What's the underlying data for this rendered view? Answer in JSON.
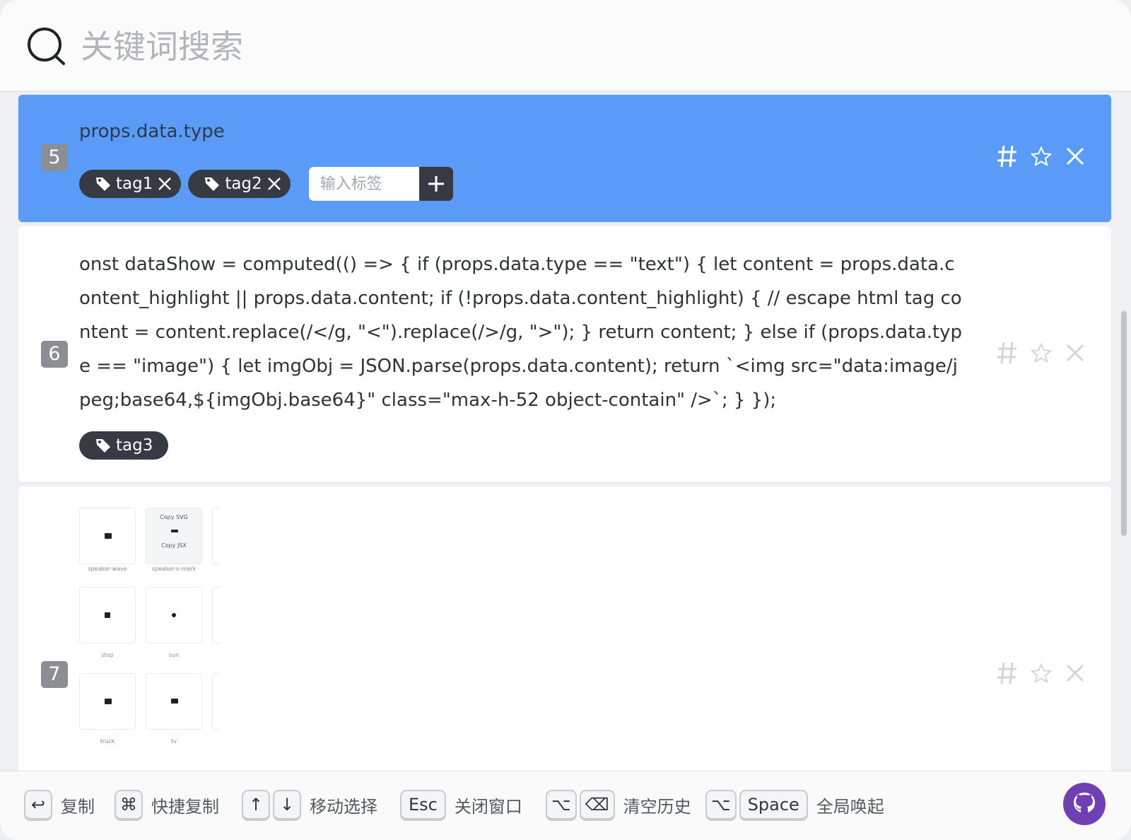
{
  "search": {
    "placeholder": "关键词搜索"
  },
  "items": [
    {
      "index": "5",
      "text": "props.data.type",
      "tags": [
        "tag1",
        "tag2"
      ],
      "tag_input_placeholder": "输入标签"
    },
    {
      "index": "6",
      "text": "onst dataShow = computed(() => { if (props.data.type == \"text\") { let content = props.data.content_highlight || props.data.content; if (!props.data.content_highlight) { // escape html tag content = content.replace(/</g, \"<\").replace(/>/g, \">\"); } return content; } else if (props.data.type == \"image\") { let imgObj = JSON.parse(props.data.content); return `<img src=\"data:image/jpeg;base64,${imgObj.base64}\" class=\"max-h-52 object-contain\" />`; } });",
      "tags": [
        "tag3"
      ]
    },
    {
      "index": "7",
      "image_labels": {
        "copy_svg": "Copy SVG",
        "copy_jsx": "Copy JSX",
        "cells": [
          "speaker-wave",
          "speaker-x-mark",
          "stop",
          "sun",
          "truck",
          "tv"
        ]
      }
    }
  ],
  "footer": {
    "hints": [
      {
        "keys": [
          "↩"
        ],
        "label": "复制"
      },
      {
        "keys": [
          "⌘"
        ],
        "label": "快捷复制"
      },
      {
        "keys": [
          "↑",
          "↓"
        ],
        "label": "移动选择"
      },
      {
        "keys": [
          "Esc"
        ],
        "label": "关闭窗口"
      },
      {
        "keys": [
          "⌥",
          "⌫"
        ],
        "label": "清空历史"
      },
      {
        "keys": [
          "⌥",
          "Space"
        ],
        "label": "全局唤起"
      }
    ]
  },
  "icons": [
    "search-icon",
    "hash-icon",
    "star-icon",
    "close-icon",
    "tag-icon",
    "plus-icon",
    "github-icon"
  ],
  "colors": {
    "active_item": "#5b9bf8",
    "tag_bg": "#363b43",
    "badge_bg": "#8b8e92"
  }
}
